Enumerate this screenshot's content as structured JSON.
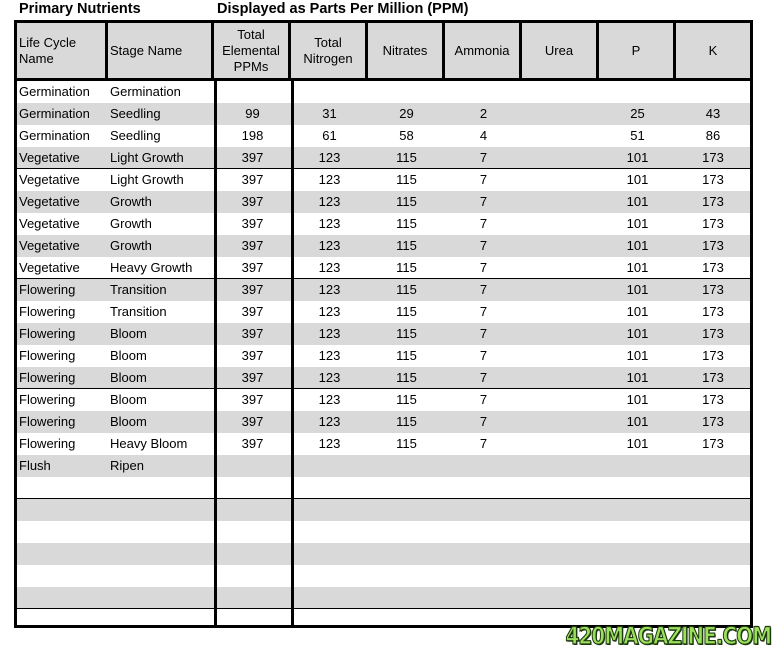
{
  "titles": {
    "left": "Primary Nutrients",
    "right": "Displayed as Parts Per Million (PPM)"
  },
  "headers": [
    "Life Cycle Name",
    "Stage Name",
    "Total Elemental PPMs",
    "Total Nitrogen",
    "Nitrates",
    "Ammonia",
    "Urea",
    "P",
    "K"
  ],
  "rows": [
    [
      "Germination",
      "Germination",
      "",
      "",
      "",
      "",
      "",
      "",
      ""
    ],
    [
      "Germination",
      "Seedling",
      "99",
      "31",
      "29",
      "2",
      "",
      "25",
      "43"
    ],
    [
      "Germination",
      "Seedling",
      "198",
      "61",
      "58",
      "4",
      "",
      "51",
      "86"
    ],
    [
      "Vegetative",
      "Light Growth",
      "397",
      "123",
      "115",
      "7",
      "",
      "101",
      "173"
    ],
    [
      "Vegetative",
      "Light Growth",
      "397",
      "123",
      "115",
      "7",
      "",
      "101",
      "173"
    ],
    [
      "Vegetative",
      "Growth",
      "397",
      "123",
      "115",
      "7",
      "",
      "101",
      "173"
    ],
    [
      "Vegetative",
      "Growth",
      "397",
      "123",
      "115",
      "7",
      "",
      "101",
      "173"
    ],
    [
      "Vegetative",
      "Growth",
      "397",
      "123",
      "115",
      "7",
      "",
      "101",
      "173"
    ],
    [
      "Vegetative",
      "Heavy Growth",
      "397",
      "123",
      "115",
      "7",
      "",
      "101",
      "173"
    ],
    [
      "Flowering",
      "Transition",
      "397",
      "123",
      "115",
      "7",
      "",
      "101",
      "173"
    ],
    [
      "Flowering",
      "Transition",
      "397",
      "123",
      "115",
      "7",
      "",
      "101",
      "173"
    ],
    [
      "Flowering",
      "Bloom",
      "397",
      "123",
      "115",
      "7",
      "",
      "101",
      "173"
    ],
    [
      "Flowering",
      "Bloom",
      "397",
      "123",
      "115",
      "7",
      "",
      "101",
      "173"
    ],
    [
      "Flowering",
      "Bloom",
      "397",
      "123",
      "115",
      "7",
      "",
      "101",
      "173"
    ],
    [
      "Flowering",
      "Bloom",
      "397",
      "123",
      "115",
      "7",
      "",
      "101",
      "173"
    ],
    [
      "Flowering",
      "Bloom",
      "397",
      "123",
      "115",
      "7",
      "",
      "101",
      "173"
    ],
    [
      "Flowering",
      "Heavy Bloom",
      "397",
      "123",
      "115",
      "7",
      "",
      "101",
      "173"
    ],
    [
      "Flush",
      "Ripen",
      "",
      "",
      "",
      "",
      "",
      "",
      ""
    ],
    [
      "",
      "",
      "",
      "",
      "",
      "",
      "",
      "",
      ""
    ],
    [
      "",
      "",
      "",
      "",
      "",
      "",
      "",
      "",
      ""
    ],
    [
      "",
      "",
      "",
      "",
      "",
      "",
      "",
      "",
      ""
    ],
    [
      "",
      "",
      "",
      "",
      "",
      "",
      "",
      "",
      ""
    ],
    [
      "",
      "",
      "",
      "",
      "",
      "",
      "",
      "",
      ""
    ],
    [
      "",
      "",
      "",
      "",
      "",
      "",
      "",
      "",
      ""
    ],
    [
      "",
      "",
      "",
      "",
      "",
      "",
      "",
      "",
      ""
    ]
  ],
  "colors": {
    "stripe": "#d9d9d9",
    "header_bg": "#d9d9d9",
    "watermark": "#9be05a"
  },
  "watermark": "420MAGAZINE.COM"
}
